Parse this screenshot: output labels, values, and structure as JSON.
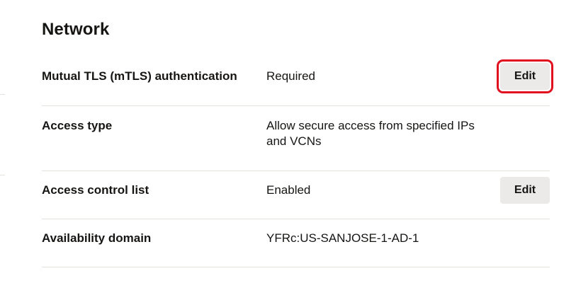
{
  "section": {
    "title": "Network"
  },
  "rows": [
    {
      "label": "Mutual TLS (mTLS) authentication",
      "value": "Required",
      "action": "Edit"
    },
    {
      "label": "Access type",
      "value": "Allow secure access from specified IPs and VCNs"
    },
    {
      "label": "Access control list",
      "value": "Enabled",
      "action": "Edit"
    },
    {
      "label": "Availability domain",
      "value": "YFRc:US-SANJOSE-1-AD-1"
    }
  ],
  "highlight_color": "#e0101e"
}
